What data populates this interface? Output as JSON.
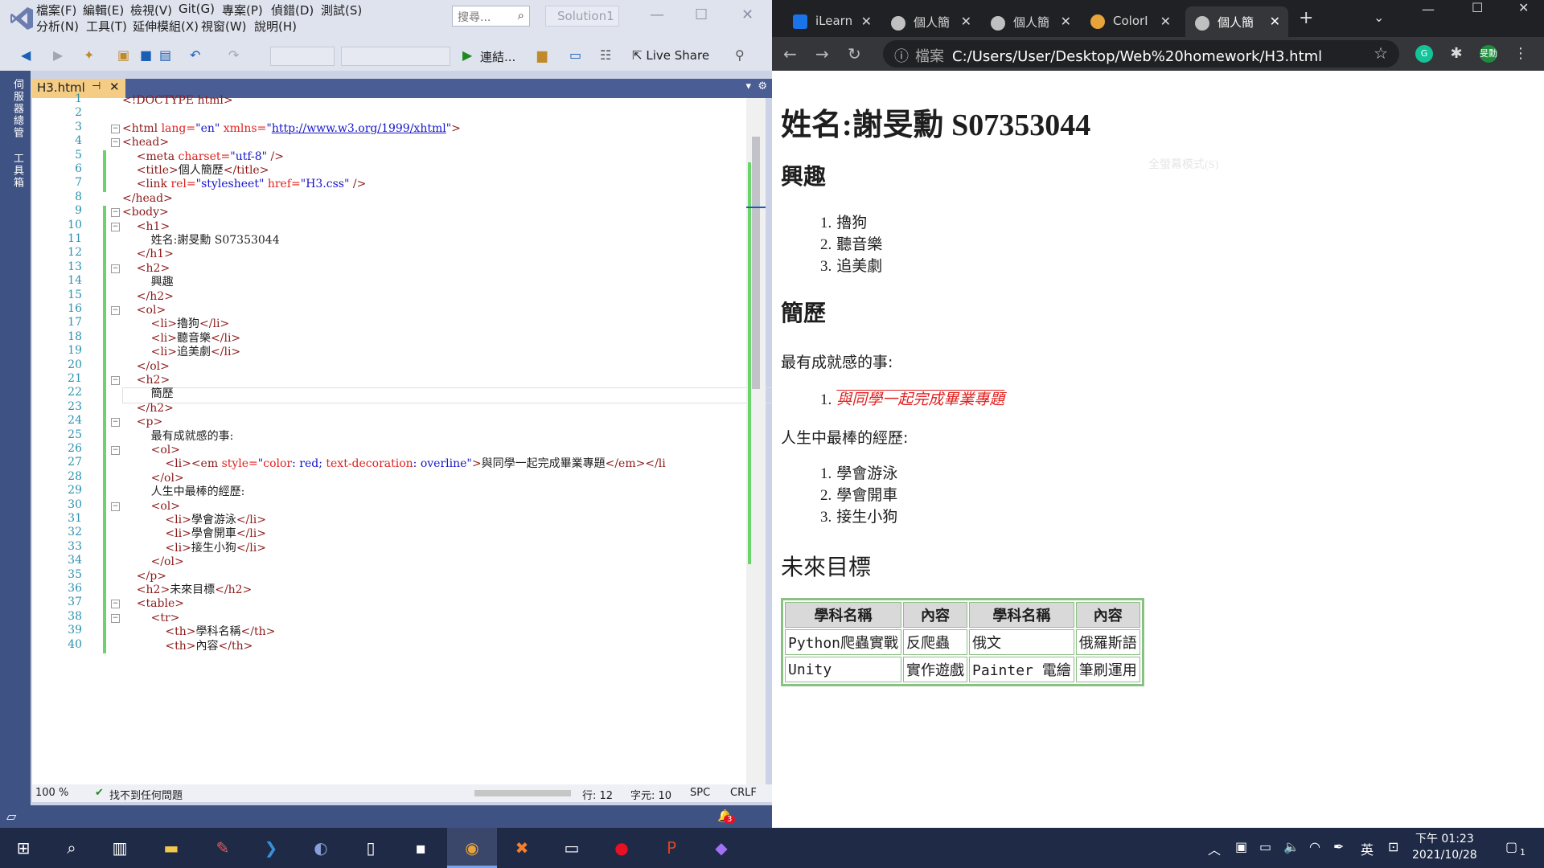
{
  "vs": {
    "menu_row1": [
      "檔案(F)",
      "編輯(E)",
      "檢視(V)",
      "Git(G)",
      "專案(P)",
      "偵錯(D)",
      "測試(S)"
    ],
    "menu_row2": [
      "分析(N)",
      "工具(T)",
      "延伸模組(X)",
      "視窗(W)",
      "說明(H)"
    ],
    "search_placeholder": "搜尋...",
    "solution_name": "Solution1",
    "toolbar_attach": "連結...",
    "live_share": "Live Share",
    "rail_labels": [
      "伺服器總管",
      "工具箱"
    ],
    "doc_tab": "H3.html",
    "code_lines": [
      [
        [
          "t",
          "<!DOCTYPE html>"
        ]
      ],
      [],
      [
        [
          "t",
          "<html "
        ],
        [
          "a",
          "lang="
        ],
        [
          "s",
          "\"en\" "
        ],
        [
          "a",
          "xmlns="
        ],
        [
          "s",
          "\""
        ],
        [
          "u",
          "http://www.w3.org/1999/xhtml"
        ],
        [
          "s",
          "\""
        ],
        [
          "t",
          ">"
        ]
      ],
      [
        [
          "t",
          "<head>"
        ]
      ],
      [
        [
          "t",
          "    <meta "
        ],
        [
          "a",
          "charset="
        ],
        [
          "s",
          "\"utf-8\" "
        ],
        [
          "t",
          "/>"
        ]
      ],
      [
        [
          "t",
          "    <title>"
        ],
        [
          "txt",
          "個人簡歷"
        ],
        [
          "t",
          "</title>"
        ]
      ],
      [
        [
          "t",
          "    <link "
        ],
        [
          "a",
          "rel="
        ],
        [
          "s",
          "\"stylesheet\" "
        ],
        [
          "a",
          "href="
        ],
        [
          "s",
          "\"H3.css\" "
        ],
        [
          "t",
          "/>"
        ]
      ],
      [
        [
          "t",
          "</head>"
        ]
      ],
      [
        [
          "t",
          "<body>"
        ]
      ],
      [
        [
          "t",
          "    <h1>"
        ]
      ],
      [
        [
          "txt",
          "        姓名:謝旻勳 S07353044"
        ]
      ],
      [
        [
          "t",
          "    </h1>"
        ]
      ],
      [
        [
          "t",
          "    <h2>"
        ]
      ],
      [
        [
          "txt",
          "        興趣"
        ]
      ],
      [
        [
          "t",
          "    </h2>"
        ]
      ],
      [
        [
          "t",
          "    <ol>"
        ]
      ],
      [
        [
          "t",
          "        <li>"
        ],
        [
          "txt",
          "擼狗"
        ],
        [
          "t",
          "</li>"
        ]
      ],
      [
        [
          "t",
          "        <li>"
        ],
        [
          "txt",
          "聽音樂"
        ],
        [
          "t",
          "</li>"
        ]
      ],
      [
        [
          "t",
          "        <li>"
        ],
        [
          "txt",
          "追美劇"
        ],
        [
          "t",
          "</li>"
        ]
      ],
      [
        [
          "t",
          "    </ol>"
        ]
      ],
      [
        [
          "t",
          "    <h2>"
        ]
      ],
      [
        [
          "txt",
          "        簡歷"
        ]
      ],
      [
        [
          "t",
          "    </h2>"
        ]
      ],
      [
        [
          "t",
          "    <p>"
        ]
      ],
      [
        [
          "txt",
          "        最有成就感的事:"
        ]
      ],
      [
        [
          "t",
          "        <ol>"
        ]
      ],
      [
        [
          "t",
          "            <li><em "
        ],
        [
          "a",
          "style="
        ],
        [
          "s",
          "\""
        ],
        [
          "a",
          "color"
        ],
        [
          "s",
          ": red; "
        ],
        [
          "a",
          "text-decoration"
        ],
        [
          "s",
          ": overline\""
        ],
        [
          "t",
          ">"
        ],
        [
          "txt",
          "與同學一起完成畢業專題"
        ],
        [
          "t",
          "</em></li"
        ]
      ],
      [
        [
          "t",
          "        </ol>"
        ]
      ],
      [
        [
          "txt",
          "        人生中最棒的經歷:"
        ]
      ],
      [
        [
          "t",
          "        <ol>"
        ]
      ],
      [
        [
          "t",
          "            <li>"
        ],
        [
          "txt",
          "學會游泳"
        ],
        [
          "t",
          "</li>"
        ]
      ],
      [
        [
          "t",
          "            <li>"
        ],
        [
          "txt",
          "學會開車"
        ],
        [
          "t",
          "</li>"
        ]
      ],
      [
        [
          "t",
          "            <li>"
        ],
        [
          "txt",
          "接生小狗"
        ],
        [
          "t",
          "</li>"
        ]
      ],
      [
        [
          "t",
          "        </ol>"
        ]
      ],
      [
        [
          "t",
          "    </p>"
        ]
      ],
      [
        [
          "t",
          "    <h2>"
        ],
        [
          "txt",
          "未來目標"
        ],
        [
          "t",
          "</h2>"
        ]
      ],
      [
        [
          "t",
          "    <table>"
        ]
      ],
      [
        [
          "t",
          "        <tr>"
        ]
      ],
      [
        [
          "t",
          "            <th>"
        ],
        [
          "txt",
          "學科名稱"
        ],
        [
          "t",
          "</th>"
        ]
      ],
      [
        [
          "t",
          "            <th>"
        ],
        [
          "txt",
          "內容"
        ],
        [
          "t",
          "</th>"
        ]
      ]
    ],
    "status": {
      "zoom": "100 %",
      "issues": "找不到任何問題",
      "line": "行: 12",
      "col": "字元: 10",
      "spc": "SPC",
      "crlf": "CRLF"
    },
    "notif_count": "3"
  },
  "browser": {
    "tabs": [
      {
        "label": "iLearn",
        "icon": "ilearn-icon"
      },
      {
        "label": "個人簡",
        "icon": "globe-icon"
      },
      {
        "label": "個人簡",
        "icon": "globe-icon"
      },
      {
        "label": "ColorI",
        "icon": "colorful-icon"
      },
      {
        "label": "個人簡",
        "icon": "globe-icon"
      }
    ],
    "url_scheme": "檔案",
    "url": "C:/Users/User/Desktop/Web%20homework/H3.html",
    "profile_label": "旻勳",
    "faint_text": "全螢幕模式(S)"
  },
  "page": {
    "h1": "姓名:謝旻勳 S07353044",
    "interest_heading": "興趣",
    "interests": [
      "擼狗",
      "聽音樂",
      "追美劇"
    ],
    "resume_heading": "簡歷",
    "proud_label": "最有成就感的事:",
    "proud_items": [
      "與同學一起完成畢業專題"
    ],
    "best_label": "人生中最棒的經歷:",
    "best_items": [
      "學會游泳",
      "學會開車",
      "接生小狗"
    ],
    "future_heading": "未來目標",
    "table_headers": [
      "學科名稱",
      "內容",
      "學科名稱",
      "內容"
    ],
    "table_rows": [
      [
        "Python爬蟲實戰",
        "反爬蟲",
        "俄文",
        "俄羅斯語"
      ],
      [
        "Unity",
        "實作遊戲",
        "Painter 電繪",
        "筆刷運用"
      ]
    ]
  },
  "taskbar": {
    "ime": "英",
    "time": "下午 01:23",
    "date": "2021/10/28",
    "notif": "1"
  },
  "colors": {
    "vs_accent": "#3f5284",
    "change_bar": "#6bd36b",
    "em_red": "#e02020",
    "table_border": "#8bc084"
  }
}
